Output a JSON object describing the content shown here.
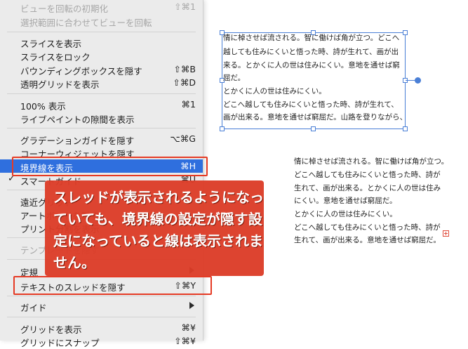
{
  "menu": {
    "items": [
      {
        "label": "ビューを回転の初期化",
        "shortcut": "⇧⌘1",
        "disabled": true
      },
      {
        "label": "選択範囲に合わせてビューを回転",
        "shortcut": "",
        "disabled": true
      },
      {
        "label": "スライスを表示",
        "shortcut": ""
      },
      {
        "label": "スライスをロック",
        "shortcut": ""
      },
      {
        "label": "バウンディングボックスを隠す",
        "shortcut": "⇧⌘B"
      },
      {
        "label": "透明グリッドを表示",
        "shortcut": "⇧⌘D"
      },
      {
        "label": "100% 表示",
        "shortcut": "⌘1"
      },
      {
        "label": "ライブペイントの隙間を表示",
        "shortcut": ""
      },
      {
        "label": "グラデーションガイドを隠す",
        "shortcut": "⌥⌘G"
      },
      {
        "label": "コーナーウィジェットを隠す",
        "shortcut": ""
      },
      {
        "label": "境界線を表示",
        "shortcut": "⌘H",
        "highlighted": true
      },
      {
        "label": "スマートガイド",
        "shortcut": "⌘U",
        "checked": true,
        "check": "✓"
      },
      {
        "label": "遠近グリッド",
        "shortcut": ""
      },
      {
        "label": "アートボードを隠す",
        "shortcut": ""
      },
      {
        "label": "プリント分割を表示",
        "shortcut": ""
      },
      {
        "label": "テンプレートを隠す",
        "shortcut": "",
        "disabled": true
      },
      {
        "label": "定規",
        "shortcut": "",
        "submenu": true
      },
      {
        "label": "テキストのスレッドを隠す",
        "shortcut": "⇧⌘Y"
      },
      {
        "label": "ガイド",
        "shortcut": "",
        "submenu": true
      },
      {
        "label": "グリッドを表示",
        "shortcut": "⌘¥"
      },
      {
        "label": "グリッドにスナップ",
        "shortcut": "⇧⌘¥"
      }
    ]
  },
  "callout": {
    "lines": [
      "スレッドが表示されるようになっ",
      "ていても、境界線の設定が隠す設",
      "定になっていると線は表示されま",
      "せん。"
    ]
  },
  "text_frame_1": {
    "lines": [
      "情に棹させば流される。智に働けば角が立つ。どこへ",
      "越しても住みにくいと悟った時、詩が生れて、画が出",
      "来る。とかくに人の世は住みにくい。意地を通せば窮",
      "屈だ。",
      "とかくに人の世は住みにくい。",
      "どこへ越しても住みにくいと悟った時、詩が生れて、",
      "画が出来る。意地を通せば窮屈だ。山路を登りながら、"
    ]
  },
  "text_frame_2": {
    "lines": [
      "情に棹させば流される。智に働けば角が立つ。",
      "どこへ越しても住みにくいと悟った時、詩が",
      "生れて、画が出来る。とかくに人の世は住み",
      "にくい。意地を通せば窮屈だ。",
      "とかくに人の世は住みにくい。",
      "どこへ越しても住みにくいと悟った時、詩が",
      "生れて、画が出来る。意地を通せば窮屈だ。"
    ]
  },
  "colors": {
    "highlight": "#2f6fde",
    "annotation_red": "#e53a24",
    "selection_blue": "#4a7fd6"
  }
}
